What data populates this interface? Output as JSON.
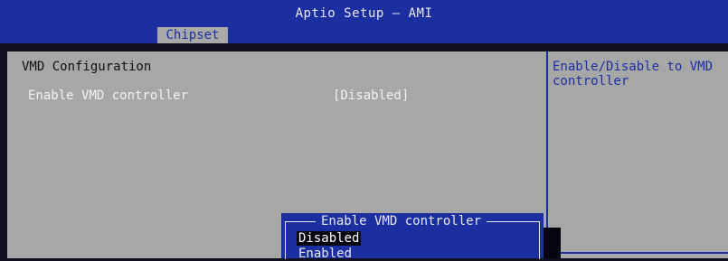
{
  "header": {
    "title": "Aptio Setup – AMI"
  },
  "tabs": [
    {
      "label": "Chipset"
    }
  ],
  "main": {
    "section_title": "VMD Configuration",
    "settings": [
      {
        "label": "Enable VMD controller",
        "value": "[Disabled]"
      }
    ]
  },
  "help": {
    "text": "Enable/Disable to VMD controller"
  },
  "popup": {
    "title": "Enable VMD controller",
    "options": [
      "Disabled",
      "Enabled"
    ],
    "selected": "Disabled"
  },
  "colors": {
    "header_blue": "#1c2fa0",
    "panel_gray": "#a7a7a7",
    "highlight": "#050510"
  }
}
